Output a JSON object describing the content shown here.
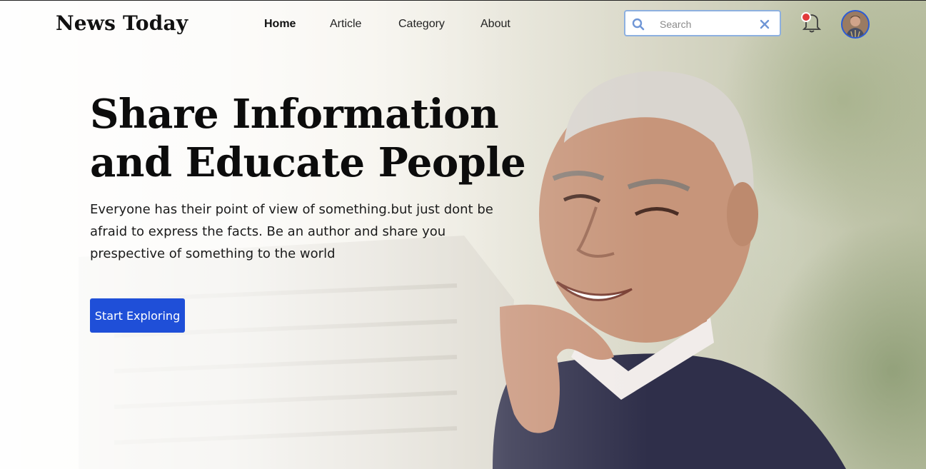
{
  "brand": {
    "logo_text": "News Today"
  },
  "nav": {
    "items": [
      {
        "label": "Home",
        "active": true
      },
      {
        "label": "Article",
        "active": false
      },
      {
        "label": "Category",
        "active": false
      },
      {
        "label": "About",
        "active": false
      }
    ]
  },
  "search": {
    "placeholder": "Search",
    "value": "",
    "search_icon": "search-icon",
    "clear_icon": "close-icon"
  },
  "notifications": {
    "icon": "bell-icon",
    "has_unread": true,
    "dot_color": "#e23b3b"
  },
  "user": {
    "avatar_icon": "avatar"
  },
  "hero": {
    "title_line1": "Share Information",
    "title_line2": "and Educate People",
    "description": "Everyone has their point of view of something.but just dont be afraid to express the facts. Be an author and share you prespective of something to the world",
    "cta_label": "Start Exploring"
  },
  "colors": {
    "accent": "#1f4fd8",
    "search_border": "#8db0e0",
    "avatar_ring": "#2a5bd7"
  }
}
